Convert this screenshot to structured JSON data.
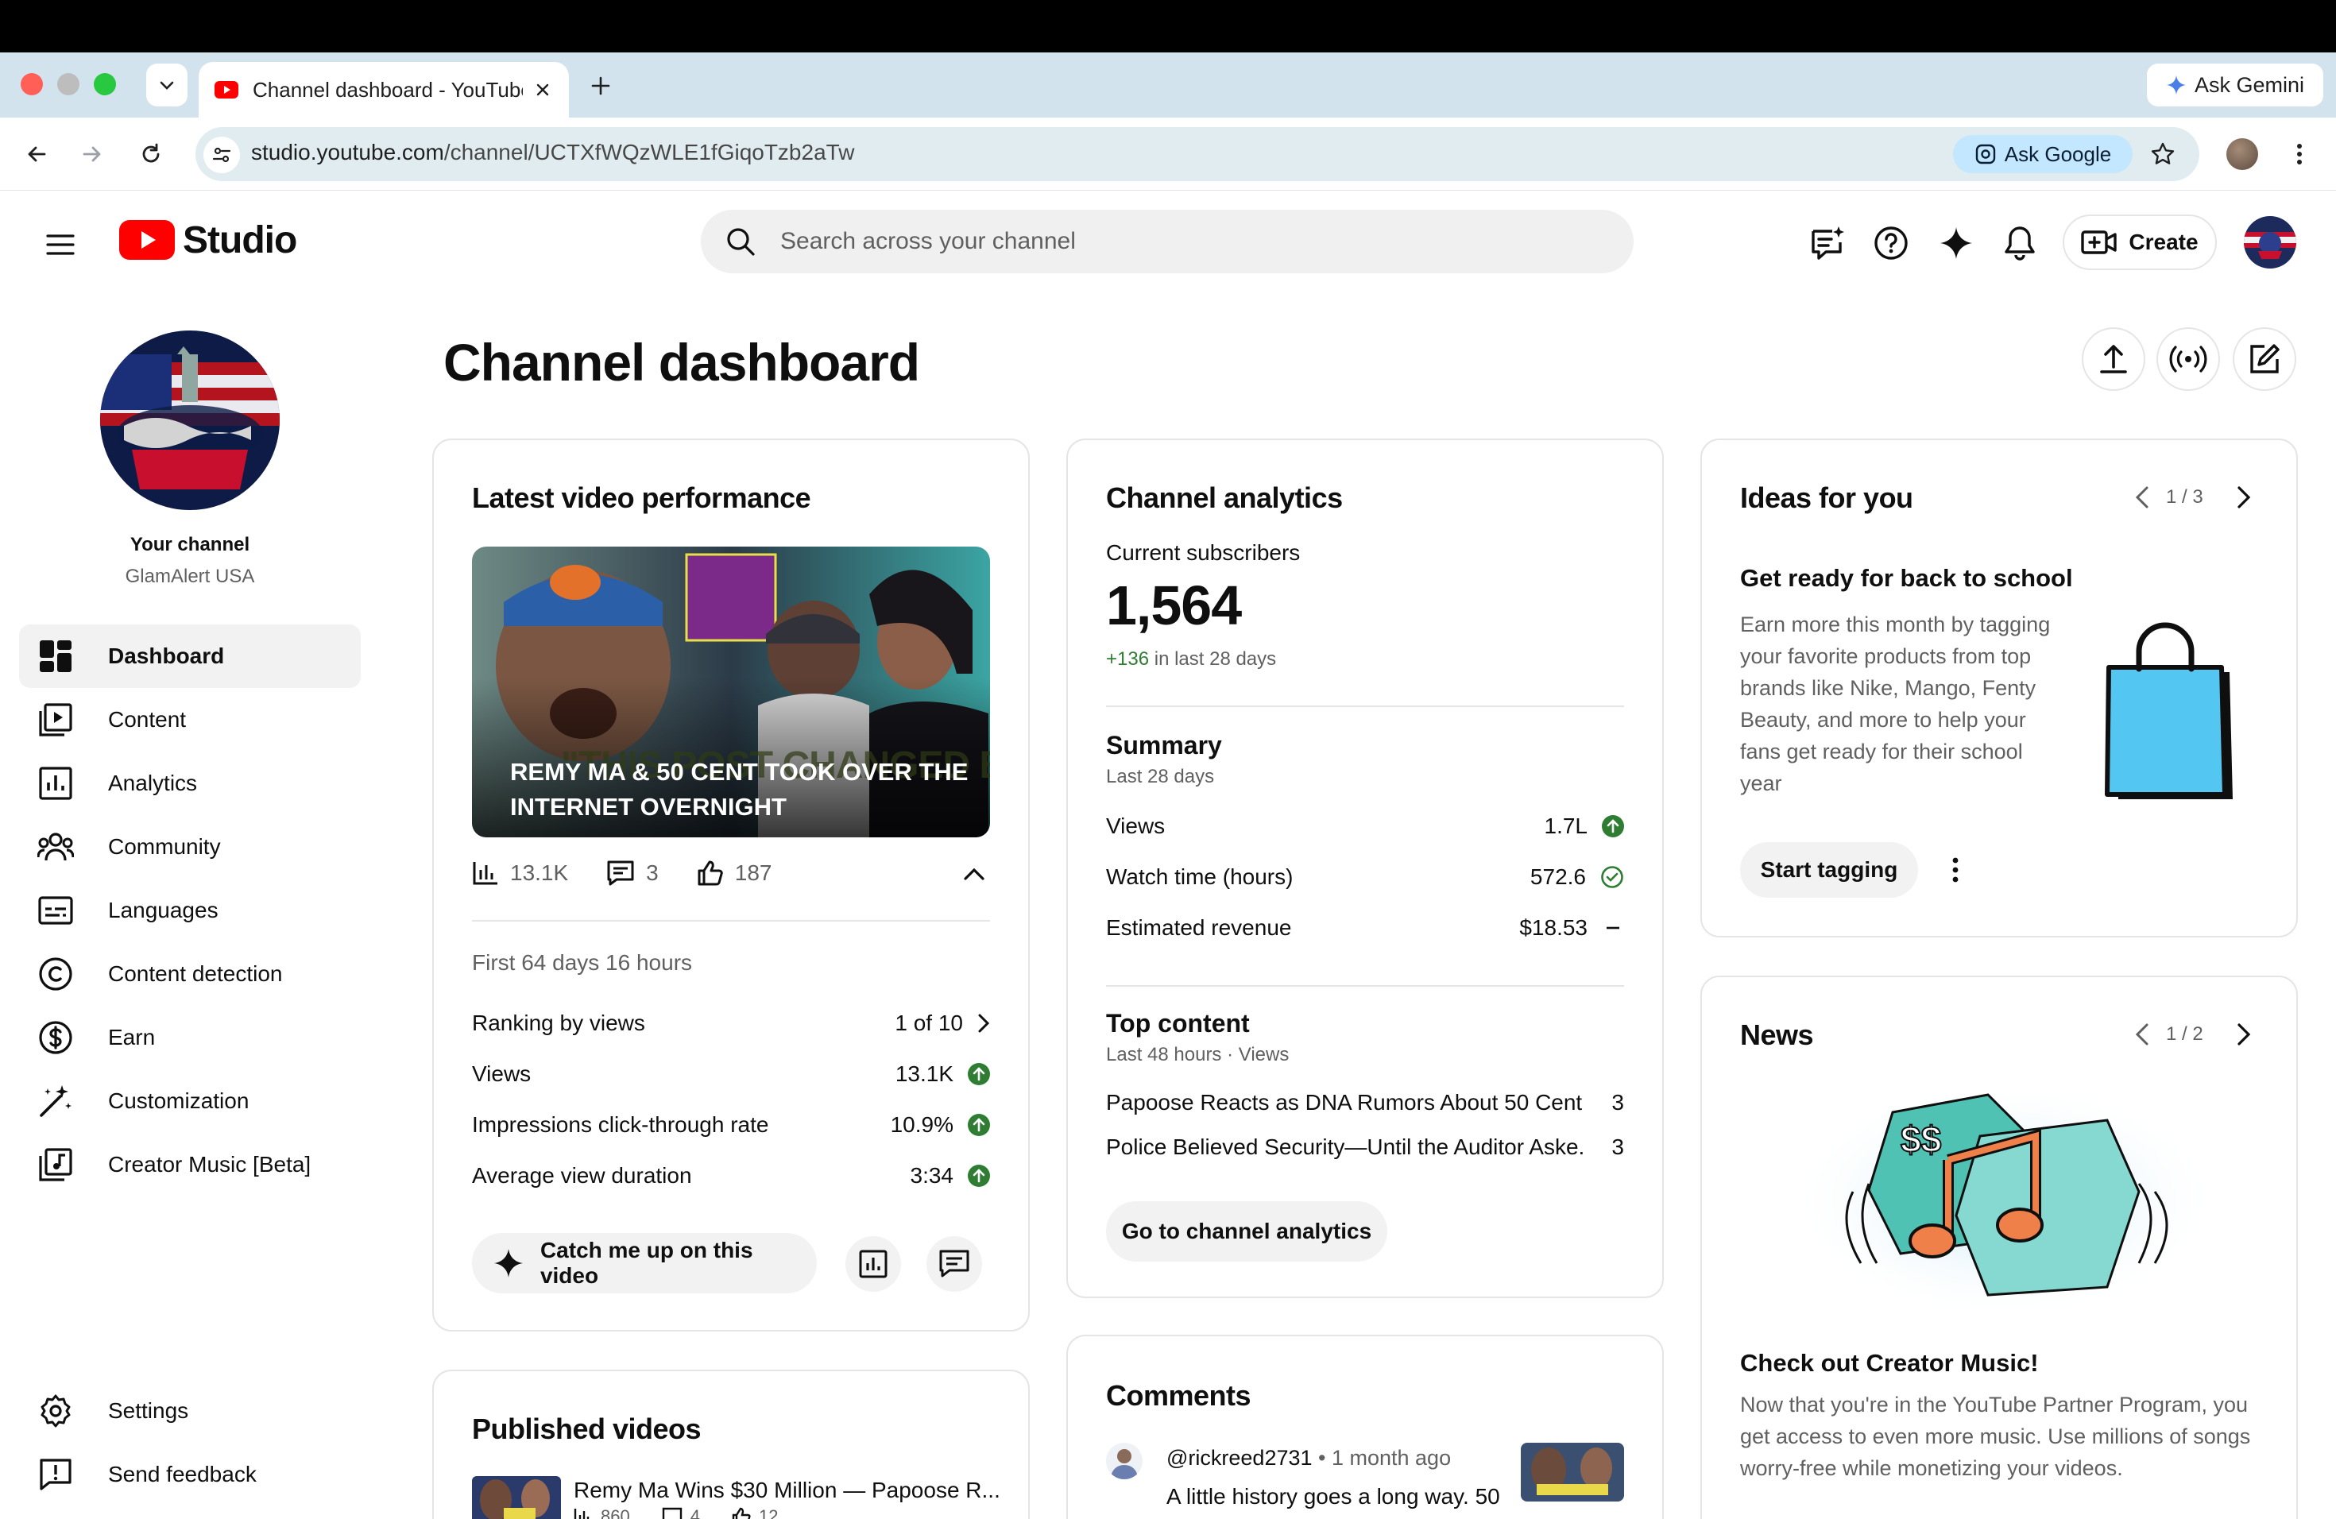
{
  "browser": {
    "tab_title": "Channel dashboard - YouTube Studio",
    "ask_gemini": "Ask Gemini",
    "url_host": "studio.youtube.com",
    "url_path": "/channel/UCTXfWQzWLE1fGiqoTzb2aTw",
    "ask_google": "Ask Google"
  },
  "header": {
    "logo_text": "Studio",
    "search_placeholder": "Search across your channel",
    "create_label": "Create"
  },
  "sidebar": {
    "your_channel": "Your channel",
    "channel_name": "GlamAlert USA",
    "items": [
      {
        "label": "Dashboard"
      },
      {
        "label": "Content"
      },
      {
        "label": "Analytics"
      },
      {
        "label": "Community"
      },
      {
        "label": "Languages"
      },
      {
        "label": "Content detection"
      },
      {
        "label": "Earn"
      },
      {
        "label": "Customization"
      },
      {
        "label": "Creator Music [Beta]"
      }
    ],
    "bottom_items": [
      {
        "label": "Settings"
      },
      {
        "label": "Send feedback"
      }
    ]
  },
  "page": {
    "title": "Channel dashboard"
  },
  "latest_video": {
    "title": "Latest video performance",
    "thumb_caption": "REMY MA & 50 CENT TOOK OVER THE INTERNET OVERNIGHT",
    "thumb_overlay": "\"THIS POST CHANGED EVERYTHING\"",
    "views": "13.1K",
    "comments": "3",
    "likes": "187",
    "period": "First 64 days 16 hours",
    "rows": [
      {
        "label": "Ranking by views",
        "value": "1 of 10"
      },
      {
        "label": "Views",
        "value": "13.1K"
      },
      {
        "label": "Impressions click-through rate",
        "value": "10.9%"
      },
      {
        "label": "Average view duration",
        "value": "3:34"
      }
    ],
    "catch_up": "Catch me up on this video"
  },
  "analytics": {
    "title": "Channel analytics",
    "subs_label": "Current subscribers",
    "subs_value": "1,564",
    "subs_change": "+136",
    "subs_change_suffix": "in last 28 days",
    "summary_title": "Summary",
    "summary_period": "Last 28 days",
    "summary_rows": [
      {
        "label": "Views",
        "value": "1.7L"
      },
      {
        "label": "Watch time (hours)",
        "value": "572.6"
      },
      {
        "label": "Estimated revenue",
        "value": "$18.53"
      }
    ],
    "top_title": "Top content",
    "top_period": "Last 48 hours · Views",
    "top_rows": [
      {
        "label": "Papoose Reacts as DNA Rumors About 50 Cent ...",
        "value": "3"
      },
      {
        "label": "Police Believed Security—Until the Auditor Aske...",
        "value": "3"
      }
    ],
    "go_btn": "Go to channel analytics"
  },
  "ideas": {
    "title": "Ideas for you",
    "pager": "1 / 3",
    "heading": "Get ready for back to school",
    "body": "Earn more this month by tagging your favorite products from top brands like Nike, Mango, Fenty Beauty, and more to help your fans get ready for their school year",
    "cta": "Start tagging"
  },
  "news": {
    "title": "News",
    "pager": "1 / 2",
    "heading": "Check out Creator Music!",
    "body": "Now that you're in the YouTube Partner Program, you get access to even more music. Use millions of songs worry-free while monetizing your videos."
  },
  "published": {
    "title": "Published videos",
    "item_title": "Remy Ma Wins $30 Million — Papoose R...",
    "item_views": "860",
    "item_comments": "4",
    "item_likes": "12"
  },
  "comments": {
    "title": "Comments",
    "author": "@rickreed2731",
    "time": "• 1 month ago",
    "text": "A little history goes a long way. 50"
  },
  "colors": {
    "youtube_red": "#ff0000",
    "up_green": "#2e7d32",
    "ask_google_bg": "#c2e7ff"
  }
}
